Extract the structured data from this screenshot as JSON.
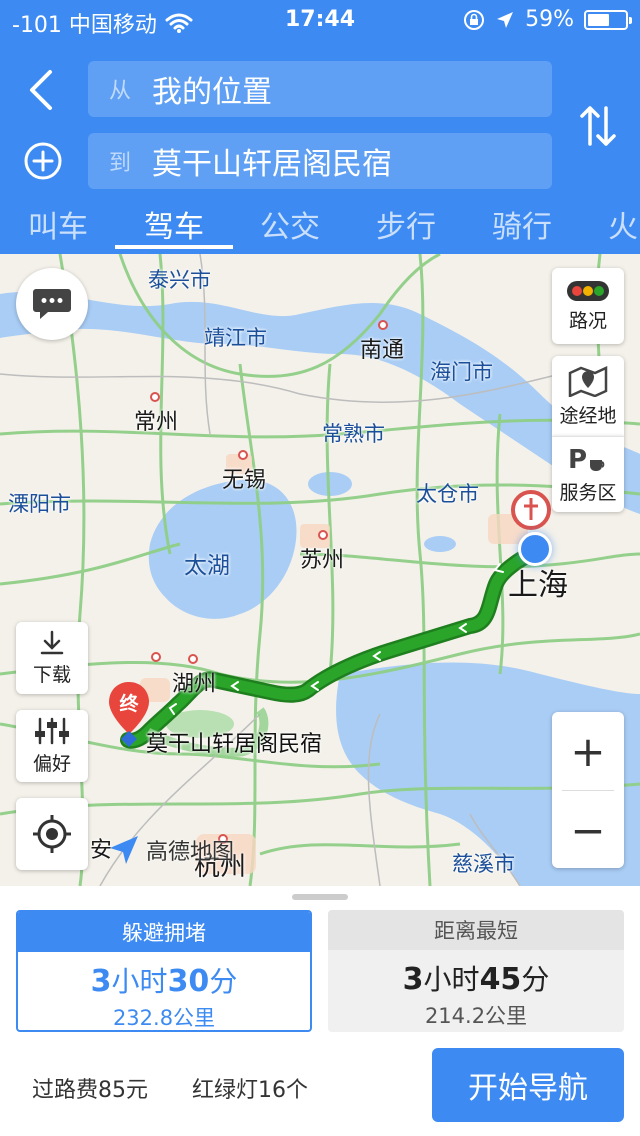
{
  "status_bar": {
    "carrier": "-101 中国移动",
    "time": "17:44",
    "battery": "59%",
    "battery_level": 0.59
  },
  "header": {
    "from_prefix": "从",
    "from_value": "我的位置",
    "to_prefix": "到",
    "to_value": "莫干山轩居阁民宿",
    "tabs": [
      {
        "label": "叫车"
      },
      {
        "label": "驾车",
        "active": true
      },
      {
        "label": "公交"
      },
      {
        "label": "步行"
      },
      {
        "label": "骑行"
      },
      {
        "label": "火"
      }
    ]
  },
  "map": {
    "cities": {
      "taixing": "泰兴市",
      "jingjiang": "靖江市",
      "nantong": "南通",
      "haimen": "海门市",
      "changzhou": "常州",
      "changshu": "常熟市",
      "wuxi": "无锡",
      "liyang": "溧阳市",
      "taicang": "太仓市",
      "taihu": "太湖",
      "suzhou": "苏州",
      "shanghai": "上海",
      "huzhou": "湖州",
      "hangzhou": "杭州",
      "cixi": "慈溪市",
      "an": "安"
    },
    "controls": {
      "traffic": "路况",
      "waypoint": "途经地",
      "service_area": "服务区",
      "download": "下载",
      "preference": "偏好",
      "zoom_in": "+",
      "zoom_out": "−"
    },
    "end_marker": "终",
    "destination_label": "莫干山轩居阁民宿",
    "brand": "高德地图"
  },
  "routes": [
    {
      "tag": "躲避拥堵",
      "hours": "3",
      "h_unit": "小时",
      "minutes": "30",
      "m_unit": "分",
      "distance": "232.8公里",
      "selected": true
    },
    {
      "tag": "距离最短",
      "hours": "3",
      "h_unit": "小时",
      "minutes": "45",
      "m_unit": "分",
      "distance": "214.2公里",
      "selected": false
    }
  ],
  "footer": {
    "toll": "过路费85元",
    "lights": "红绿灯16个",
    "start_button": "开始导航"
  },
  "colors": {
    "accent": "#3d8bf2",
    "route": "#2aa52a",
    "water": "#a9cdf5"
  }
}
